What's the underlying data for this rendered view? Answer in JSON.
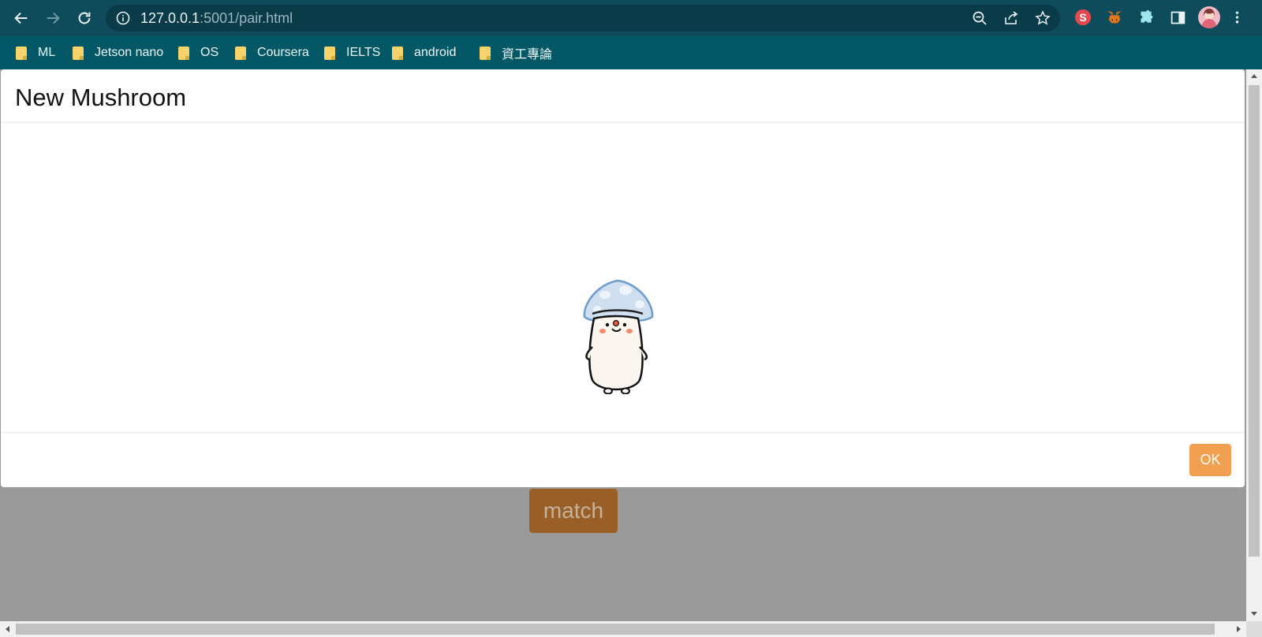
{
  "browser": {
    "url_host": "127.0.0.1",
    "url_path": ":5001/pair.html",
    "icons": [
      "back-icon",
      "forward-icon",
      "reload-icon",
      "info-icon",
      "zoom-out-icon",
      "share-icon",
      "star-icon",
      "extension-s-icon",
      "metamask-icon",
      "puzzle-icon",
      "sidepanel-icon",
      "avatar",
      "menu-icon"
    ],
    "extension_s_label": "S",
    "accent": "#0e4c5c"
  },
  "bookmarks": [
    {
      "label": "ML"
    },
    {
      "label": "Jetson nano"
    },
    {
      "label": "OS"
    },
    {
      "label": "Coursera"
    },
    {
      "label": "IELTS"
    },
    {
      "label": "android"
    },
    {
      "label": "資工專論"
    }
  ],
  "modal": {
    "title": "New Mushroom",
    "ok_label": "OK",
    "image": "mushroom-character"
  },
  "page": {
    "match_label": "match"
  }
}
